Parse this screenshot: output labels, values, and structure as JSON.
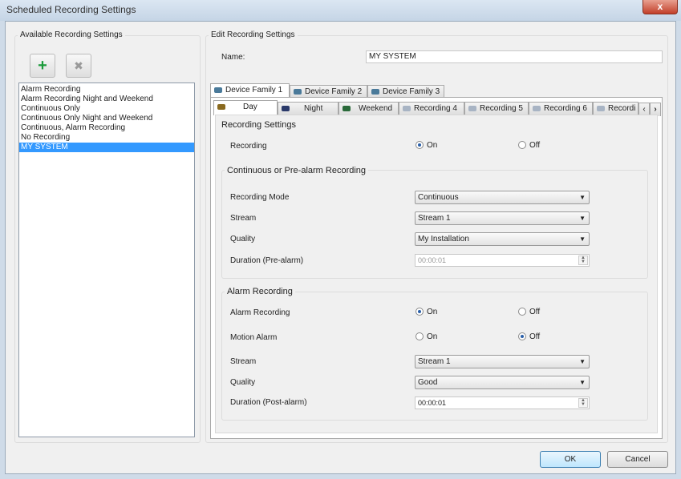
{
  "window": {
    "title": "Scheduled Recording Settings",
    "close": "x"
  },
  "left": {
    "group_label": "Available Recording Settings",
    "add": "+",
    "delete": "✖",
    "items": [
      "Alarm Recording",
      "Alarm Recording Night and Weekend",
      "Continuous Only",
      "Continuous Only Night and Weekend",
      "Continuous, Alarm Recording",
      "No Recording",
      "MY SYSTEM"
    ],
    "selected_index": 6
  },
  "right": {
    "group_label": "Edit Recording Settings",
    "name_label": "Name:",
    "name_value": "MY SYSTEM",
    "family_tabs": [
      "Device Family 1",
      "Device Family 2",
      "Device Family 3"
    ],
    "schedule_tabs": [
      "Day",
      "Night",
      "Weekend",
      "Recording 4",
      "Recording 5",
      "Recording 6",
      "Recordi"
    ],
    "scroll_left": "‹",
    "scroll_right": "›",
    "recording_settings": {
      "header": "Recording Settings",
      "recording_label": "Recording",
      "on": "On",
      "off": "Off",
      "recording_value": "On"
    },
    "continuous": {
      "header": "Continuous or Pre-alarm Recording",
      "mode_label": "Recording Mode",
      "mode_value": "Continuous",
      "stream_label": "Stream",
      "stream_value": "Stream 1",
      "quality_label": "Quality",
      "quality_value": "My Installation",
      "duration_label": "Duration (Pre-alarm)",
      "duration_value": "00:00:01"
    },
    "alarm": {
      "header": "Alarm Recording",
      "alarm_label": "Alarm Recording",
      "alarm_value": "On",
      "motion_label": "Motion Alarm",
      "motion_value": "Off",
      "on": "On",
      "off": "Off",
      "stream_label": "Stream",
      "stream_value": "Stream 1",
      "quality_label": "Quality",
      "quality_value": "Good",
      "duration_label": "Duration (Post-alarm)",
      "duration_value": "00:00:01"
    }
  },
  "footer": {
    "ok": "OK",
    "cancel": "Cancel"
  },
  "colors": {
    "selection": "#3399ff",
    "add_icon": "#1a9a3a"
  }
}
